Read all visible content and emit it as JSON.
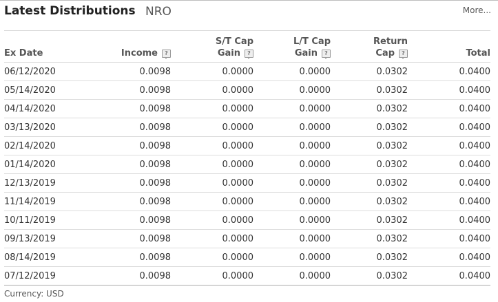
{
  "header": {
    "title": "Latest Distributions",
    "ticker": "NRO",
    "more_label": "More..."
  },
  "table": {
    "columns": {
      "ex_date": "Ex Date",
      "income": "Income",
      "st_cap_gain_line1": "S/T Cap",
      "st_cap_gain_line2": "Gain",
      "lt_cap_gain_line1": "L/T Cap",
      "lt_cap_gain_line2": "Gain",
      "return_cap_line1": "Return",
      "return_cap_line2": "Cap",
      "total": "Total"
    },
    "help_icon": "?",
    "rows": [
      {
        "ex_date": "06/12/2020",
        "income": "0.0098",
        "st_cap_gain": "0.0000",
        "lt_cap_gain": "0.0000",
        "return_cap": "0.0302",
        "total": "0.0400"
      },
      {
        "ex_date": "05/14/2020",
        "income": "0.0098",
        "st_cap_gain": "0.0000",
        "lt_cap_gain": "0.0000",
        "return_cap": "0.0302",
        "total": "0.0400"
      },
      {
        "ex_date": "04/14/2020",
        "income": "0.0098",
        "st_cap_gain": "0.0000",
        "lt_cap_gain": "0.0000",
        "return_cap": "0.0302",
        "total": "0.0400"
      },
      {
        "ex_date": "03/13/2020",
        "income": "0.0098",
        "st_cap_gain": "0.0000",
        "lt_cap_gain": "0.0000",
        "return_cap": "0.0302",
        "total": "0.0400"
      },
      {
        "ex_date": "02/14/2020",
        "income": "0.0098",
        "st_cap_gain": "0.0000",
        "lt_cap_gain": "0.0000",
        "return_cap": "0.0302",
        "total": "0.0400"
      },
      {
        "ex_date": "01/14/2020",
        "income": "0.0098",
        "st_cap_gain": "0.0000",
        "lt_cap_gain": "0.0000",
        "return_cap": "0.0302",
        "total": "0.0400"
      },
      {
        "ex_date": "12/13/2019",
        "income": "0.0098",
        "st_cap_gain": "0.0000",
        "lt_cap_gain": "0.0000",
        "return_cap": "0.0302",
        "total": "0.0400"
      },
      {
        "ex_date": "11/14/2019",
        "income": "0.0098",
        "st_cap_gain": "0.0000",
        "lt_cap_gain": "0.0000",
        "return_cap": "0.0302",
        "total": "0.0400"
      },
      {
        "ex_date": "10/11/2019",
        "income": "0.0098",
        "st_cap_gain": "0.0000",
        "lt_cap_gain": "0.0000",
        "return_cap": "0.0302",
        "total": "0.0400"
      },
      {
        "ex_date": "09/13/2019",
        "income": "0.0098",
        "st_cap_gain": "0.0000",
        "lt_cap_gain": "0.0000",
        "return_cap": "0.0302",
        "total": "0.0400"
      },
      {
        "ex_date": "08/14/2019",
        "income": "0.0098",
        "st_cap_gain": "0.0000",
        "lt_cap_gain": "0.0000",
        "return_cap": "0.0302",
        "total": "0.0400"
      },
      {
        "ex_date": "07/12/2019",
        "income": "0.0098",
        "st_cap_gain": "0.0000",
        "lt_cap_gain": "0.0000",
        "return_cap": "0.0302",
        "total": "0.0400"
      }
    ]
  },
  "footer": {
    "currency": "Currency: USD"
  }
}
